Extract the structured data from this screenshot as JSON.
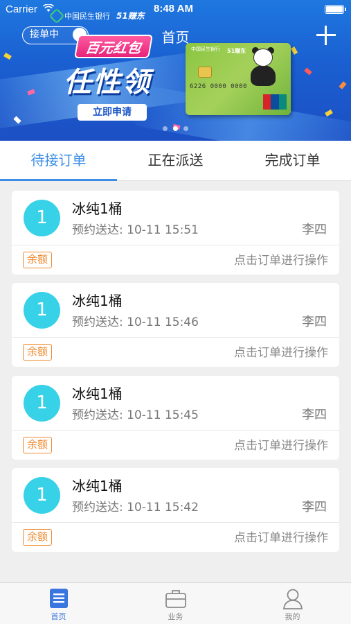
{
  "status_bar": {
    "carrier": "Carrier",
    "time": "8:48 AM"
  },
  "banner": {
    "bank_name": "中国民生银行",
    "bank_sub": "51赚东",
    "order_toggle_label": "接单中",
    "title": "首页",
    "promo_tag": "百元红包",
    "promo_big": "任性领",
    "apply_label": "立即申请",
    "card_bank": "中国民生银行",
    "card_brand": "51赚东",
    "card_number": "6226 0000 0000",
    "card_union": "UnionPay 银联",
    "slide_count": 3,
    "active_slide": 1
  },
  "tabs": [
    {
      "label": "待接订单",
      "active": true
    },
    {
      "label": "正在派送",
      "active": false
    },
    {
      "label": "完成订单",
      "active": false
    }
  ],
  "orders": [
    {
      "count": "1",
      "item": "冰纯1桶",
      "eta_label": "预约送达:",
      "eta_time": "10-11 15:51",
      "customer": "李四",
      "payment": "余额",
      "hint": "点击订单进行操作"
    },
    {
      "count": "1",
      "item": "冰纯1桶",
      "eta_label": "预约送达:",
      "eta_time": "10-11 15:46",
      "customer": "李四",
      "payment": "余额",
      "hint": "点击订单进行操作"
    },
    {
      "count": "1",
      "item": "冰纯1桶",
      "eta_label": "预约送达:",
      "eta_time": "10-11 15:45",
      "customer": "李四",
      "payment": "余额",
      "hint": "点击订单进行操作"
    },
    {
      "count": "1",
      "item": "冰纯1桶",
      "eta_label": "预约送达:",
      "eta_time": "10-11 15:42",
      "customer": "李四",
      "payment": "余额",
      "hint": "点击订单进行操作"
    }
  ],
  "tabbar": [
    {
      "label": "首页",
      "icon": "home-document-icon",
      "active": true
    },
    {
      "label": "业务",
      "icon": "briefcase-icon",
      "active": false
    },
    {
      "label": "我的",
      "icon": "person-icon",
      "active": false
    }
  ],
  "colors": {
    "accent": "#3a8ee6",
    "avatar": "#37d1e8",
    "payment_badge": "#ef8a2f",
    "banner": "#1c5fd1"
  }
}
